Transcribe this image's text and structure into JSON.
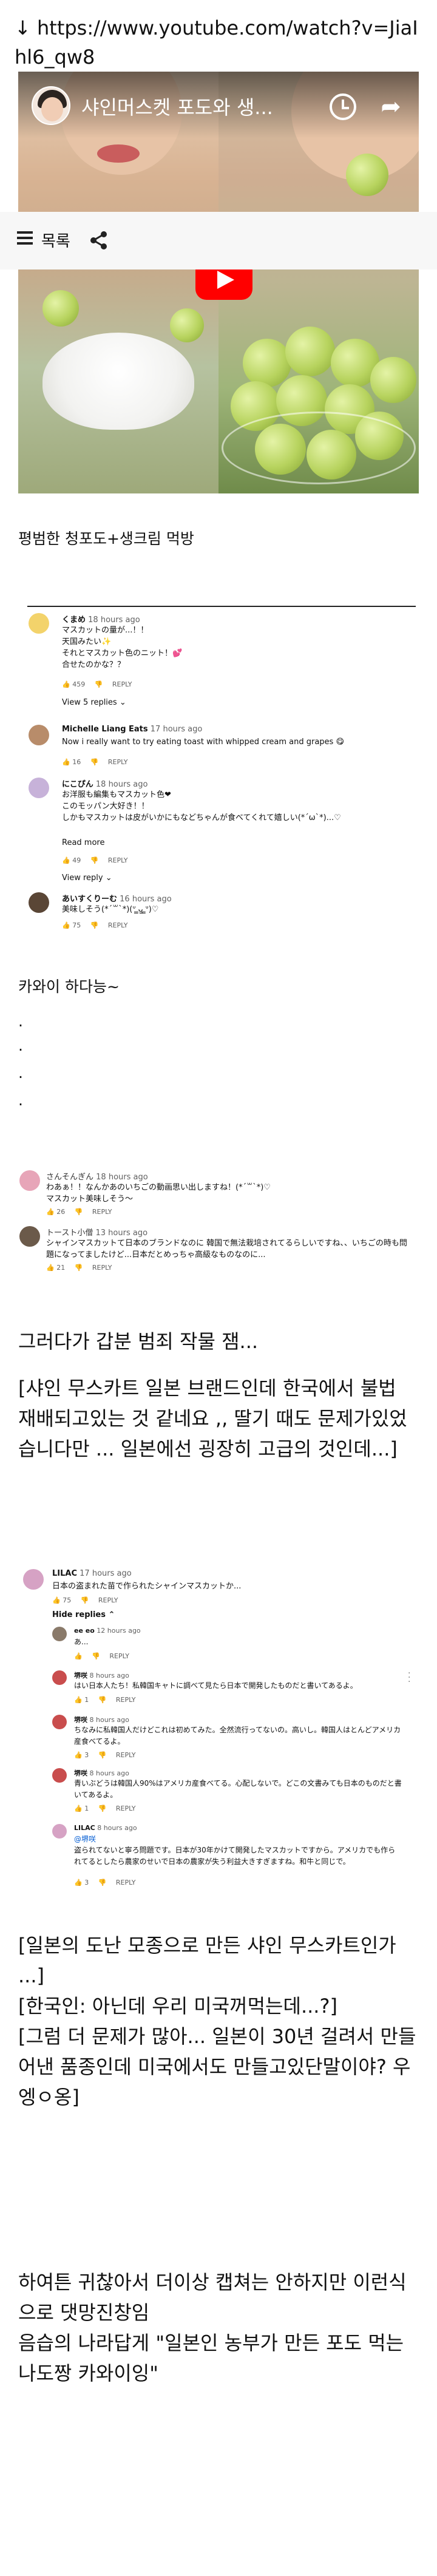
{
  "url": "↓ https://www.youtube.com/watch?v=JiaIhl6_qw8",
  "video": {
    "title": "샤인머스켓 포도와 생...",
    "list_label": "목록"
  },
  "post": {
    "p1": "평범한 청포도+생크림 먹방",
    "p2": "카와이 하다능~",
    "dots": [
      ".",
      ".",
      ".",
      "."
    ],
    "p3": "그러다가 갑분 범죄 작물 잼...",
    "p4": "[샤인 무스카트 일본 브랜드인데 한국에서 불법 재배되고있는 것 같네요 ,, 딸기 때도 문제가있었습니다만 ... 일본에선 굉장히 고급의 것인데...]",
    "p5": "[일본의 도난 모종으로 만든 샤인 무스카트인가 ...]\n[한국인: 아닌데 우리 미국꺼먹는데...?]\n[그럼 더 문제가 많아... 일본이 30년 걸려서 만들어낸 품종인데 미국에서도 만들고있단말이야? 우엥ㅇ옹]",
    "p6": "하여튼 귀찮아서 더이상 캡쳐는 안하지만 이런식으로 댓망진창임\n음습의 나라답게 \"일본인 농부가 만든 포도 먹는 나도짱 카와이잉\""
  },
  "shot1": {
    "comments": [
      {
        "author": "くまめ",
        "time": "18 hours ago",
        "body": "マスカットの量が...！！\n天国みたい✨\nそれとマスカット色のニット！💕\n合せたのかな？？",
        "likes": "459",
        "reply": "REPLY",
        "replies_link": "View 5 replies ⌄"
      },
      {
        "author": "Michelle Liang Eats",
        "time": "17 hours ago",
        "body": "Now i really want to try eating toast with whipped cream and grapes 😋",
        "likes": "16",
        "reply": "REPLY"
      },
      {
        "author": "にこぴん",
        "time": "18 hours ago",
        "body": "お洋服も編集もマスカット色❤\nこのモッパン大好き！！\nしかもマスカットは皮がいかにもなどちゃんが食べてくれて嬉しい(*´ω`*)...♡",
        "likes": "49",
        "reply": "REPLY",
        "read_more": "Read more",
        "replies_link": "View reply ⌄"
      },
      {
        "author": "あいすくりーむ",
        "time": "16 hours ago",
        "body": "美味しそう(*´꒳`*)(ᐡ ̳ᴗ̫ ̳ᐡ)♡",
        "likes": "75",
        "reply": "REPLY"
      }
    ]
  },
  "shot2": {
    "comments": [
      {
        "author": "さんそんぎん",
        "time": "18 hours ago",
        "body": "わあぁ！！なんかあのいちごの動画思い出しますね！(*´꒳`*)♡\nマスカット美味しそう〜",
        "likes": "26",
        "reply": "REPLY"
      },
      {
        "author": "トースト小僧",
        "time": "13 hours ago",
        "body": "シャインマスカットて日本のブランドなのに 韓国で無法栽培されてるらしいですね、、いちごの時も問題になってましたけど...日本だとめっちゃ高級なものなのに...",
        "likes": "21",
        "reply": "REPLY"
      }
    ]
  },
  "shot3": {
    "top": {
      "author": "LILAC",
      "time": "17 hours ago",
      "body": "日本の盗まれた苗で作られたシャインマスカットか...",
      "likes": "75",
      "reply": "REPLY",
      "hide": "Hide replies ⌃"
    },
    "replies": [
      {
        "author": "ee eo",
        "time": "12 hours ago",
        "body": "あ...",
        "likes": "",
        "reply": "REPLY"
      },
      {
        "author": "堺咲",
        "time": "8 hours ago",
        "body": "はい日本人たち！私韓国キャトに調べて見たら日本で開発したものだと書いてあるよ。",
        "likes": "1",
        "reply": "REPLY"
      },
      {
        "author": "堺咲",
        "time": "8 hours ago",
        "body": "ちなみに私韓国人だけどこれは初めてみた。全然流行ってないの。高いし。韓国人はとんどアメリカ産食べてるよ。",
        "likes": "3",
        "reply": "REPLY"
      },
      {
        "author": "堺咲",
        "time": "8 hours ago",
        "body": "青いぶどうは韓国人90%はアメリカ産食べてる。心配しないで。どこの文書みても日本のものだと書いてあるよ。",
        "likes": "1",
        "reply": "REPLY"
      },
      {
        "author": "LILAC",
        "time": "8 hours ago",
        "mention": "@堺咲",
        "body": "盗られてないと寧ろ問題です。日本が30年かけて開発したマスカットですから。アメリカでも作られてるとしたら農家のせいで日本の農家が失う利益大きすぎますね。和牛と同じで。",
        "likes": "3",
        "reply": "REPLY"
      }
    ]
  },
  "colors": {
    "youtube_red": "#ff0000",
    "meta_gray": "#606060",
    "link_blue": "#065fd4"
  }
}
